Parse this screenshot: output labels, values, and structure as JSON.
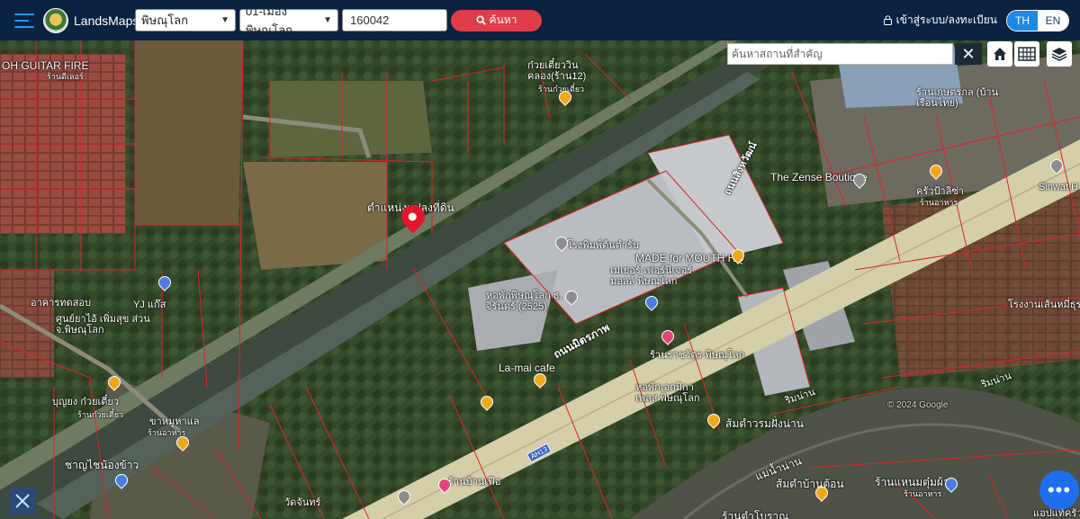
{
  "header": {
    "brand": "LandsMaps",
    "province_select": "พิษณุโลก",
    "district_select": "01-เมืองพิษณุโลก",
    "parcel_input": "160042",
    "search_label": "ค้นหา",
    "login_label": "เข้าสู่ระบบ/ลงทะเบียน",
    "lang_th": "TH",
    "lang_en": "EN"
  },
  "map_tools": {
    "place_search_placeholder": "ค้นหาสถานที่สำคัญ",
    "clear_label": "✕",
    "home_icon": "home-icon",
    "grid_icon": "grid-icon",
    "layers_icon": "layers-icon",
    "fab_label": "•••"
  },
  "labels": {
    "guitar": "OH GUITAR FIRE",
    "guitar_sub": "ร้านดีเลอร์",
    "noodle": "ก๋วยเตี๋ยววิน คลอง(ร้าน12)",
    "noodle_sub": "ร้านก๋วยเตี๋ยว",
    "parcel": "ตำแหน่งแปลงที่ดิน",
    "zense": "The Zense Boutique",
    "sinwat": "Sinwat H",
    "mouth": "MADE for MOUTH HQ",
    "printing": "โรงพิมพ์ต้นตำรับ",
    "mayer": "เมเยอร์ เฟอร์นิเจอร์ มอลล์ พิษณุโลก",
    "mayer_sub": "ร้านเฟอร์นิเจอร์",
    "dorm": "หอพักพิษณุโลก ธ. จิรันดร์ (2525)",
    "yj": "YJ แก๊ส",
    "lab": "อาคารทดสอบ",
    "pharmacy": "ศูนย์ยาไอ้ เพิ่มสุข ส่วน จ.พิษณุโลก",
    "lamai": "La-mai cafe",
    "boonyong": "บุญยง ก๋วยเตี๋ยว",
    "boonyong_sub": "ร้านก๋วยเตี๋ยว",
    "samoh": "ขาหมูหาแล",
    "samoh_sub": "ร้านอาหาร",
    "chaiyo": "ชาญไชน้องข้าว",
    "highway": "ถนนมิตรภาพ",
    "highway2": "ถนนสิงหวัฒน์",
    "ah": "AH13",
    "ratchawat": "ร้านราชวัตร พิษณุโลก",
    "dormitory2": "หอพักเอกมิกา เพลส พิษณุโลก",
    "samtam": "ส้มตำวรมฝั่งน่าน",
    "river": "แม่น้ำน่าน",
    "riverbank": "ริมน่าน",
    "warehouse": "โรงงานเส้นหมี่ธุรกิจ",
    "kaneng": "ร้านเกษตรกล (บ้านเรือนไทย)",
    "riverside_shop": "ร้านแหนมตุ๋มผ้า",
    "riverside_sub": "ร้านอาหาร",
    "somtam2": "ส้มตำบ้านต้อน",
    "sukko": "ร้านตำโบราณ",
    "wat": "วัดจันทร์",
    "copyright": "© 2024 Google",
    "kaong": "ครัวป้าลิซ่า",
    "kaong_sub": "ร้านอาหาร",
    "bakan": "ร้านบ้านเฟือ",
    "right_bottom": "แอปแท้ครัว"
  }
}
